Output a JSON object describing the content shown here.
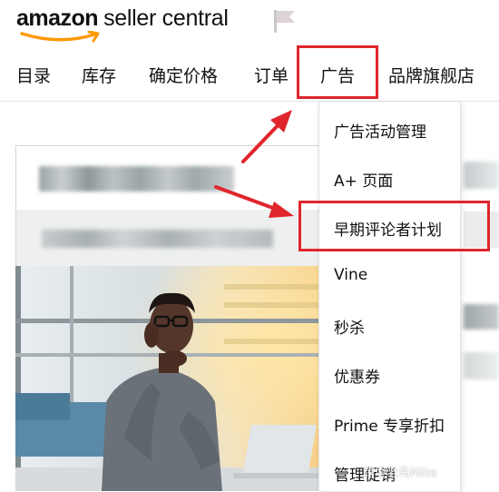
{
  "header": {
    "logo_brand": "amazon",
    "logo_product": "seller central"
  },
  "nav": {
    "items": [
      "目录",
      "库存",
      "确定价格",
      "订单",
      "广告",
      "品牌旗舰店"
    ],
    "active": "广告"
  },
  "dropdown": {
    "items": [
      "广告活动管理",
      "A+ 页面",
      "早期评论者计划",
      "Vine",
      "秒杀",
      "优惠券",
      "Prime 专享折扣",
      "管理促销"
    ],
    "highlighted": "早期评论者计划"
  },
  "watermark": "跨境老鸟Mike",
  "colors": {
    "highlight": "#e0252c",
    "logo_smile": "#ff9900",
    "text": "#111111"
  }
}
